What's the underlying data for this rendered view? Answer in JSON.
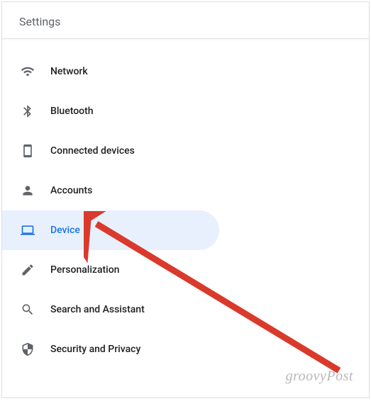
{
  "header": {
    "title": "Settings"
  },
  "sidebar": {
    "items": [
      {
        "label": "Network",
        "icon": "wifi",
        "selected": false
      },
      {
        "label": "Bluetooth",
        "icon": "bluetooth",
        "selected": false
      },
      {
        "label": "Connected devices",
        "icon": "connected-devices",
        "selected": false
      },
      {
        "label": "Accounts",
        "icon": "person",
        "selected": false
      },
      {
        "label": "Device",
        "icon": "laptop",
        "selected": true
      },
      {
        "label": "Personalization",
        "icon": "edit",
        "selected": false
      },
      {
        "label": "Search and Assistant",
        "icon": "search",
        "selected": false
      },
      {
        "label": "Security and Privacy",
        "icon": "security",
        "selected": false
      }
    ]
  },
  "watermark": "groovyPost",
  "annotation": {
    "type": "arrow",
    "color": "#d93a2b",
    "points_to": "Device"
  }
}
